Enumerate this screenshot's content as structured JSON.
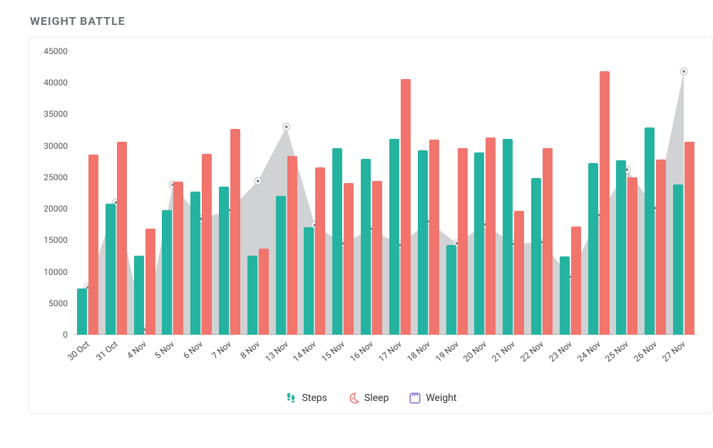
{
  "title": "WEIGHT BATTLE",
  "legend": {
    "steps": "Steps",
    "sleep": "Sleep",
    "weight": "Weight"
  },
  "chart_data": {
    "type": "bar",
    "categories": [
      "30 Oct",
      "31 Oct",
      "4 Nov",
      "5 Nov",
      "6 Nov",
      "7 Nov",
      "8 Nov",
      "13 Nov",
      "14 Nov",
      "15 Nov",
      "16 Nov",
      "17 Nov",
      "18 Nov",
      "19 Nov",
      "20 Nov",
      "21 Nov",
      "22 Nov",
      "23 Nov",
      "24 Nov",
      "25 Nov",
      "26 Nov",
      "27 Nov"
    ],
    "series": [
      {
        "name": "Steps",
        "values": [
          7300,
          20800,
          12500,
          19800,
          22700,
          23500,
          12500,
          22100,
          17100,
          29600,
          27900,
          31100,
          29300,
          14300,
          28900,
          31100,
          24900,
          12400,
          27300,
          27700,
          32900,
          23900
        ]
      },
      {
        "name": "Sleep",
        "values": [
          28600,
          30600,
          16900,
          24300,
          28700,
          32700,
          13700,
          28400,
          26600,
          24100,
          24400,
          40600,
          31000,
          29600,
          31300,
          19700,
          29600,
          17200,
          41800,
          25000,
          27800,
          30600
        ]
      },
      {
        "name": "Weight",
        "values": [
          7500,
          21000,
          800,
          23800,
          18400,
          19800,
          24400,
          33000,
          17400,
          14500,
          16800,
          14200,
          18000,
          14500,
          17500,
          14400,
          14700,
          9200,
          19000,
          26200,
          20100,
          41800
        ]
      }
    ],
    "ylim": [
      0,
      45000
    ],
    "yticks": [
      0,
      5000,
      10000,
      15000,
      20000,
      25000,
      30000,
      35000,
      40000,
      45000
    ],
    "xlabel": "",
    "ylabel": "",
    "title": "WEIGHT BATTLE"
  },
  "colors": {
    "steps": "#25b3a1",
    "sleep": "#f1746d",
    "weight": "#8a8f94"
  }
}
